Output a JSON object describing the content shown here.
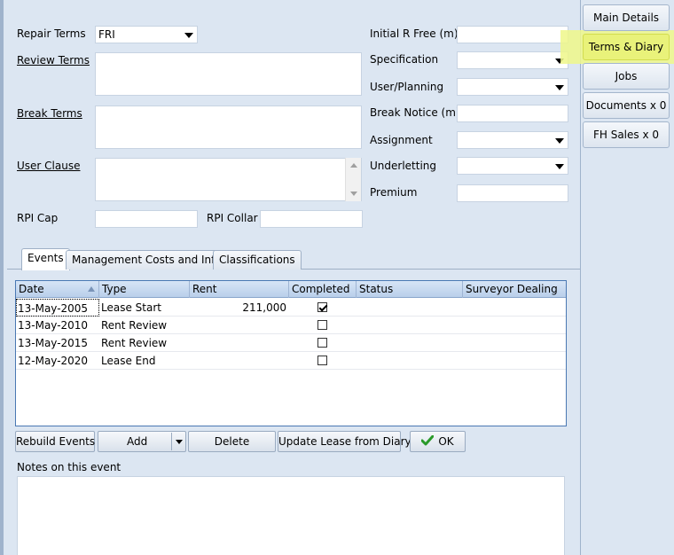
{
  "form": {
    "repair_terms_label": "Repair Terms",
    "repair_terms_value": "FRI",
    "review_terms_label": "Review Terms",
    "break_terms_label": "Break Terms",
    "user_clause_label": "User Clause",
    "rpi_cap_label": "RPI Cap",
    "rpi_collar_label": "RPI Collar",
    "initial_r_free_label": "Initial R Free (m)",
    "specification_label": "Specification",
    "user_planning_label": "User/Planning",
    "break_notice_label": "Break Notice (m)",
    "assignment_label": "Assignment",
    "underletting_label": "Underletting",
    "premium_label": "Premium"
  },
  "side_tabs": [
    {
      "label": "Main Details"
    },
    {
      "label": "Terms & Diary"
    },
    {
      "label": "Jobs"
    },
    {
      "label": "Documents x 0"
    },
    {
      "label": "FH Sales x 0"
    }
  ],
  "tabs": [
    {
      "label": "Events"
    },
    {
      "label": "Management Costs and Info"
    },
    {
      "label": "Classifications"
    }
  ],
  "grid": {
    "columns": [
      "Date",
      "Type",
      "Rent",
      "Completed",
      "Status",
      "Surveyor Dealing"
    ],
    "rows": [
      {
        "date": "13-May-2005",
        "type": "Lease Start",
        "rent": "211,000",
        "completed": true,
        "status": "",
        "surveyor": ""
      },
      {
        "date": "13-May-2010",
        "type": "Rent Review",
        "rent": "",
        "completed": false,
        "status": "",
        "surveyor": ""
      },
      {
        "date": "13-May-2015",
        "type": "Rent Review",
        "rent": "",
        "completed": false,
        "status": "",
        "surveyor": ""
      },
      {
        "date": "12-May-2020",
        "type": "Lease End",
        "rent": "",
        "completed": false,
        "status": "",
        "surveyor": ""
      }
    ]
  },
  "buttons": {
    "rebuild": "Rebuild Events",
    "add": "Add",
    "delete": "Delete",
    "update": "Update Lease from Diary",
    "ok": "OK"
  },
  "notes_label": "Notes on this event",
  "colors": {
    "highlight": "#e9f27a",
    "ok_check": "#2a9a2a",
    "grid_border": "#4a78b3"
  }
}
